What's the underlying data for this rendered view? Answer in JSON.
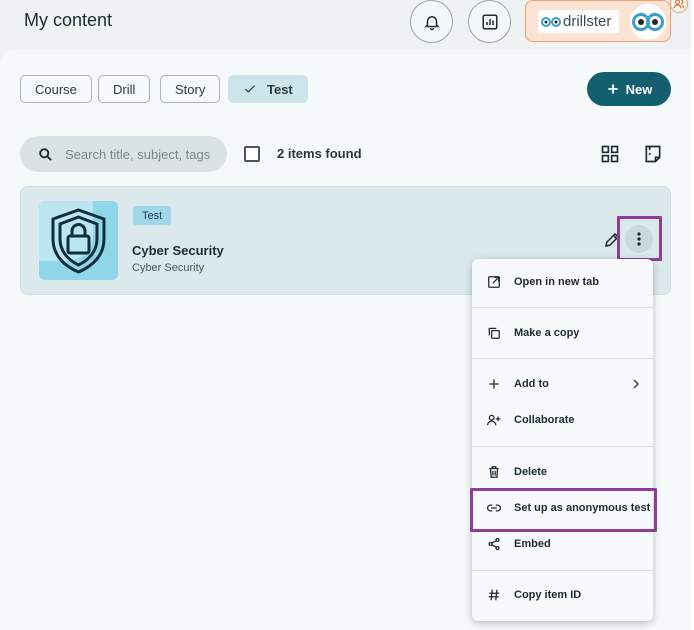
{
  "header": {
    "title": "My content",
    "notifications_icon": "bell-icon",
    "stats_icon": "bar-chart-icon",
    "brand": {
      "name": "drillster",
      "accent": "#f0a070"
    }
  },
  "filters": {
    "chips": [
      {
        "label": "Course",
        "active": false
      },
      {
        "label": "Drill",
        "active": false
      },
      {
        "label": "Story",
        "active": false
      },
      {
        "label": "Test",
        "active": true
      }
    ],
    "new_button": "New"
  },
  "search": {
    "placeholder": "Search title, subject, tags",
    "value": ""
  },
  "results": {
    "count_text": "2 items found"
  },
  "items": [
    {
      "type": "Test",
      "title": "Cyber Security",
      "subject": "Cyber Security",
      "thumb_icon": "shield-lock-icon"
    }
  ],
  "context_menu": {
    "items": [
      {
        "label": "Open in new tab",
        "icon": "external-link-icon"
      },
      {
        "label": "Make a copy",
        "icon": "copy-icon"
      },
      {
        "label": "Add to",
        "icon": "plus-icon",
        "submenu": true
      },
      {
        "label": "Collaborate",
        "icon": "add-user-icon"
      },
      {
        "label": "Delete",
        "icon": "trash-icon"
      },
      {
        "label": "Set up as anonymous test",
        "icon": "link-icon"
      },
      {
        "label": "Embed",
        "icon": "share-icon"
      },
      {
        "label": "Copy item ID",
        "icon": "hash-icon"
      }
    ]
  },
  "colors": {
    "primary": "#135f6f",
    "highlight": "#8e3e98",
    "card": "#dbe9ed",
    "badge": "#9fd6ea"
  }
}
